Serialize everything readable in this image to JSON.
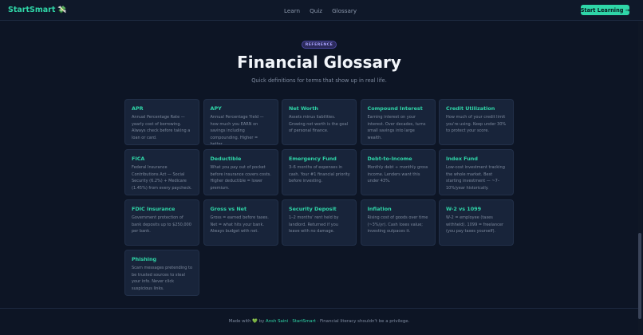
{
  "header": {
    "brand": "StartSmart",
    "brand_emoji": "💸",
    "nav": [
      "Learn",
      "Quiz",
      "Glossary"
    ],
    "cta": "Start Learning →"
  },
  "hero": {
    "badge": "REFERENCE",
    "title": "Financial Glossary",
    "subtitle": "Quick definitions for terms that show up in real life."
  },
  "terms": [
    {
      "term": "APR",
      "definition": "Annual Percentage Rate — yearly cost of borrowing. Always check before taking a loan or card."
    },
    {
      "term": "APY",
      "definition": "Annual Percentage Yield — how much you EARN on savings including compounding. Higher = better."
    },
    {
      "term": "Net Worth",
      "definition": "Assets minus liabilities. Growing net worth is the goal of personal finance."
    },
    {
      "term": "Compound Interest",
      "definition": "Earning interest on your interest. Over decades, turns small savings into large wealth."
    },
    {
      "term": "Credit Utilization",
      "definition": "How much of your credit limit you're using. Keep under 30% to protect your score."
    },
    {
      "term": "FICA",
      "definition": "Federal Insurance Contributions Act — Social Security (6.2%) + Medicare (1.45%) from every paycheck."
    },
    {
      "term": "Deductible",
      "definition": "What you pay out of pocket before insurance covers costs. Higher deductible = lower premium."
    },
    {
      "term": "Emergency Fund",
      "definition": "3–6 months of expenses in cash. Your #1 financial priority before investing."
    },
    {
      "term": "Debt-to-Income",
      "definition": "Monthly debt ÷ monthly gross income. Lenders want this under 43%."
    },
    {
      "term": "Index Fund",
      "definition": "Low-cost investment tracking the whole market. Best starting investment — ~7–10%/year historically."
    },
    {
      "term": "FDIC Insurance",
      "definition": "Government protection of bank deposits up to $250,000 per bank."
    },
    {
      "term": "Gross vs Net",
      "definition": "Gross = earned before taxes. Net = what hits your bank. Always budget with net."
    },
    {
      "term": "Security Deposit",
      "definition": "1–2 months' rent held by landlord. Returned if you leave with no damage."
    },
    {
      "term": "Inflation",
      "definition": "Rising cost of goods over time (~3%/yr). Cash loses value; investing outpaces it."
    },
    {
      "term": "W-2 vs 1099",
      "definition": "W-2 = employee (taxes withheld). 1099 = freelancer (you pay taxes yourself)."
    },
    {
      "term": "Phishing",
      "definition": "Scam messages pretending to be trusted sources to steal your info. Never click suspicious links."
    }
  ],
  "footer": {
    "made_with": "Made with",
    "heart": "💚",
    "by": "by",
    "author": "Ansh Saini",
    "separator": "·",
    "brand": "StartSmart",
    "tagline": "· Financial literacy shouldn't be a privilege."
  },
  "colors": {
    "accent": "#2fd6a8",
    "background": "#0d1525",
    "card": "#18243a",
    "badge": "#a9a3ff"
  }
}
